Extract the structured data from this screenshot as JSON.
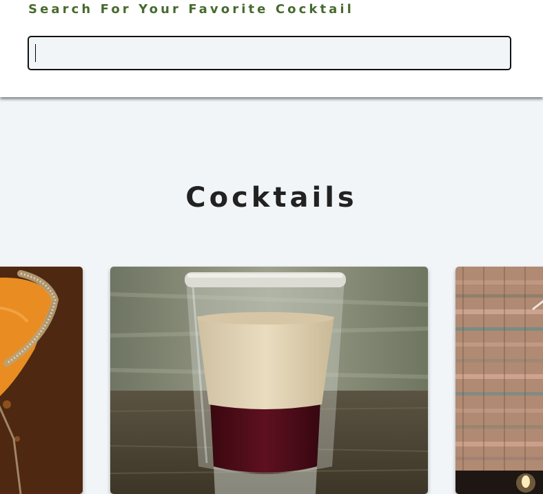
{
  "search": {
    "label": "Search For Your Favorite Cocktail",
    "value": "",
    "placeholder": ""
  },
  "section": {
    "title": "Cocktails"
  },
  "cards": [
    {
      "position": "left",
      "image": "orange-martini-sugared-rim"
    },
    {
      "position": "center",
      "image": "layered-shot-glass-salted-rim"
    },
    {
      "position": "right",
      "image": "cocktail-woven-background"
    }
  ]
}
